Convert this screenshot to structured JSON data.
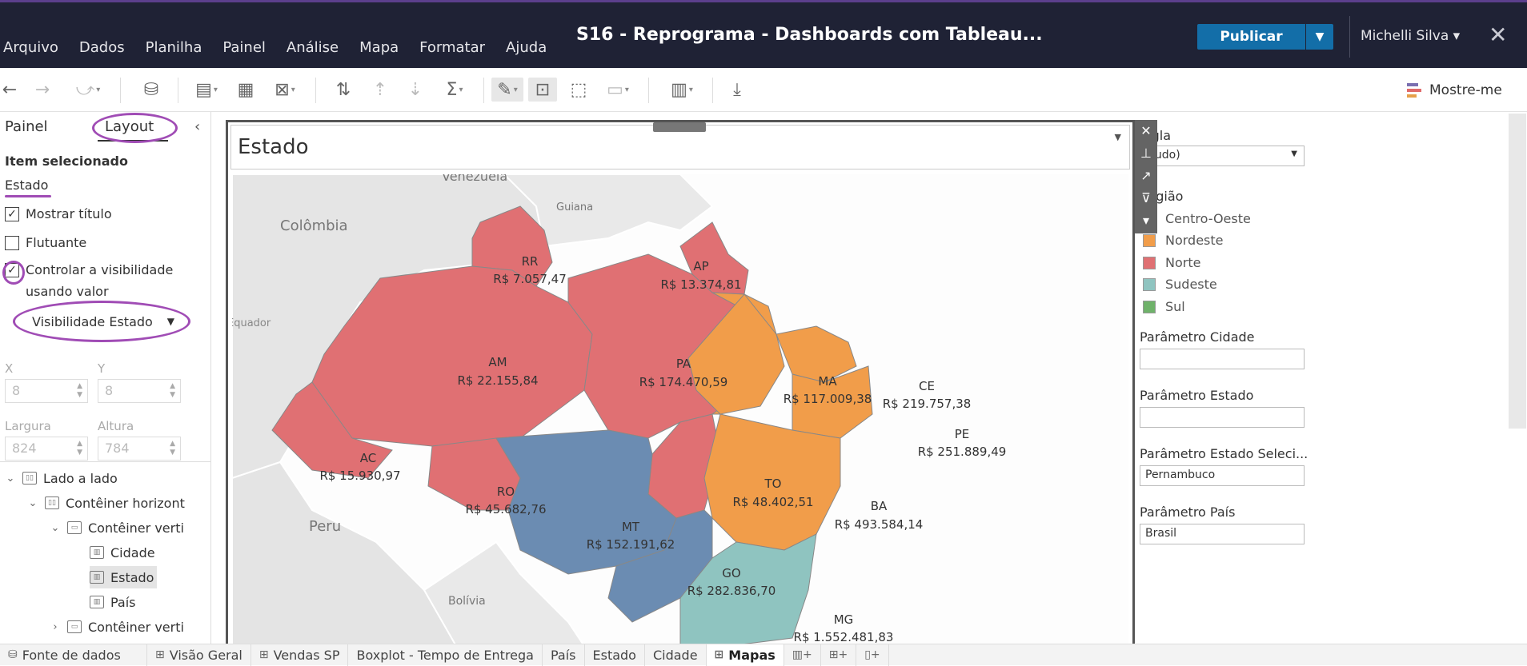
{
  "window": {
    "title": "S16 - Reprograma - Dashboards com Tableau...",
    "publish_label": "Publicar",
    "user": "Michelli Silva ▾",
    "close": "✕"
  },
  "menu": [
    "Arquivo",
    "Dados",
    "Planilha",
    "Painel",
    "Análise",
    "Mapa",
    "Formatar",
    "Ajuda"
  ],
  "toolbar": {
    "show_me_label": "Mostre-me"
  },
  "left_panel": {
    "tab_painel": "Painel",
    "tab_layout": "Layout",
    "selected_header": "Item selecionado",
    "selected_item": "Estado",
    "checkbox_show_title": {
      "label": "Mostrar título",
      "checked": true
    },
    "checkbox_floating": {
      "label": "Flutuante",
      "checked": false
    },
    "checkbox_visibility_line1": "Controlar a visibilidade",
    "checkbox_visibility_line2": "usando valor",
    "visibility_param": "Visibilidade Estado",
    "x_label": "X",
    "x_value": "8",
    "y_label": "Y",
    "y_value": "8",
    "width_label": "Largura",
    "width_value": "824",
    "height_label": "Altura",
    "height_value": "784",
    "tree": [
      {
        "label": "Lado a lado"
      },
      {
        "label": "Contêiner horizont"
      },
      {
        "label": "Contêiner verti"
      },
      {
        "label": "Cidade"
      },
      {
        "label": "Estado"
      },
      {
        "label": "País"
      },
      {
        "label": "Contêiner verti"
      }
    ]
  },
  "dashboard": {
    "zone_title": "Estado",
    "map": {
      "countries": [
        "Venezuela",
        "Guiana",
        "Colômbia",
        "Equador",
        "Peru",
        "Bolívia"
      ],
      "states": [
        {
          "uf": "RR",
          "value": "R$ 7.057,47",
          "region": "Norte"
        },
        {
          "uf": "AP",
          "value": "R$ 13.374,81",
          "region": "Norte"
        },
        {
          "uf": "AM",
          "value": "R$ 22.155,84",
          "region": "Norte"
        },
        {
          "uf": "PA",
          "value": "R$ 174.470,59",
          "region": "Norte"
        },
        {
          "uf": "AC",
          "value": "R$ 15.930,97",
          "region": "Norte"
        },
        {
          "uf": "RO",
          "value": "R$ 45.682,76",
          "region": "Norte"
        },
        {
          "uf": "TO",
          "value": "R$ 48.402,51",
          "region": "Norte"
        },
        {
          "uf": "MA",
          "value": "R$ 117.009,38",
          "region": "Nordeste"
        },
        {
          "uf": "CE",
          "value": "R$ 219.757,38",
          "region": "Nordeste"
        },
        {
          "uf": "PE",
          "value": "R$ 251.889,49",
          "region": "Nordeste"
        },
        {
          "uf": "BA",
          "value": "R$ 493.584,14",
          "region": "Nordeste"
        },
        {
          "uf": "MT",
          "value": "R$ 152.191,62",
          "region": "Centro-Oeste"
        },
        {
          "uf": "GO",
          "value": "R$ 282.836,70",
          "region": "Centro-Oeste"
        },
        {
          "uf": "MG",
          "value": "R$ 1.552.481,83",
          "region": "Sudeste"
        }
      ]
    }
  },
  "filters": {
    "sigla_label": "Sigla",
    "sigla_value": "(Tudo)",
    "regiao_label": "Região",
    "legend": [
      {
        "name": "Centro-Oeste",
        "color": "#6b8cb2"
      },
      {
        "name": "Nordeste",
        "color": "#f19d4a"
      },
      {
        "name": "Norte",
        "color": "#e07073"
      },
      {
        "name": "Sudeste",
        "color": "#8fc4c0"
      },
      {
        "name": "Sul",
        "color": "#6fb26a"
      }
    ],
    "param_cidade_label": "Parâmetro Cidade",
    "param_cidade_value": "",
    "param_estado_label": "Parâmetro Estado",
    "param_estado_value": "",
    "param_estado_sel_label": "Parâmetro Estado Seleci...",
    "param_estado_sel_value": "Pernambuco",
    "param_pais_label": "Parâmetro País",
    "param_pais_value": "Brasil"
  },
  "bottom_tabs": [
    {
      "label": "Fonte de dados",
      "active": false
    },
    {
      "label": "Visão Geral",
      "active": false
    },
    {
      "label": "Vendas SP",
      "active": false
    },
    {
      "label": "Boxplot - Tempo de Entrega",
      "active": false
    },
    {
      "label": "País",
      "active": false
    },
    {
      "label": "Estado",
      "active": false
    },
    {
      "label": "Cidade",
      "active": false
    },
    {
      "label": "Mapas",
      "active": true
    }
  ]
}
